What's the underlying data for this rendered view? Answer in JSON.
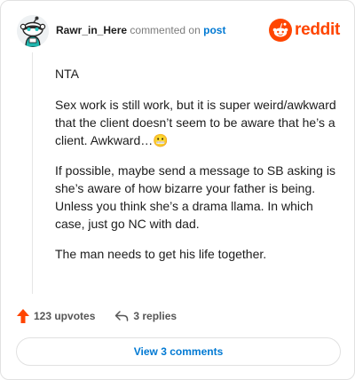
{
  "comment": {
    "author": "Rawr_in_Here",
    "action_text": "commented on",
    "target_text": "post",
    "paragraphs": [
      "NTA",
      "Sex work is still work, but it is super weird/awkward that the client doesn’t seem to be aware that he’s a client. Awkward…😬",
      "If possible, maybe send a message to SB asking is she’s aware of how bizarre your father is being. Unless you think she’s a drama llama. In which case, just go NC with dad.",
      "The man needs to get his life together."
    ]
  },
  "brand": {
    "name": "reddit",
    "color": "#ff4500"
  },
  "actions": {
    "upvotes_label": "123 upvotes",
    "replies_label": "3 replies",
    "upvote_icon": "upvote-arrow-icon",
    "reply_icon": "reply-arrow-icon"
  },
  "footer": {
    "view_comments_label": "View 3 comments"
  },
  "colors": {
    "link": "#0079d3",
    "upvote": "#ff4500",
    "muted": "#7c7c7c"
  }
}
